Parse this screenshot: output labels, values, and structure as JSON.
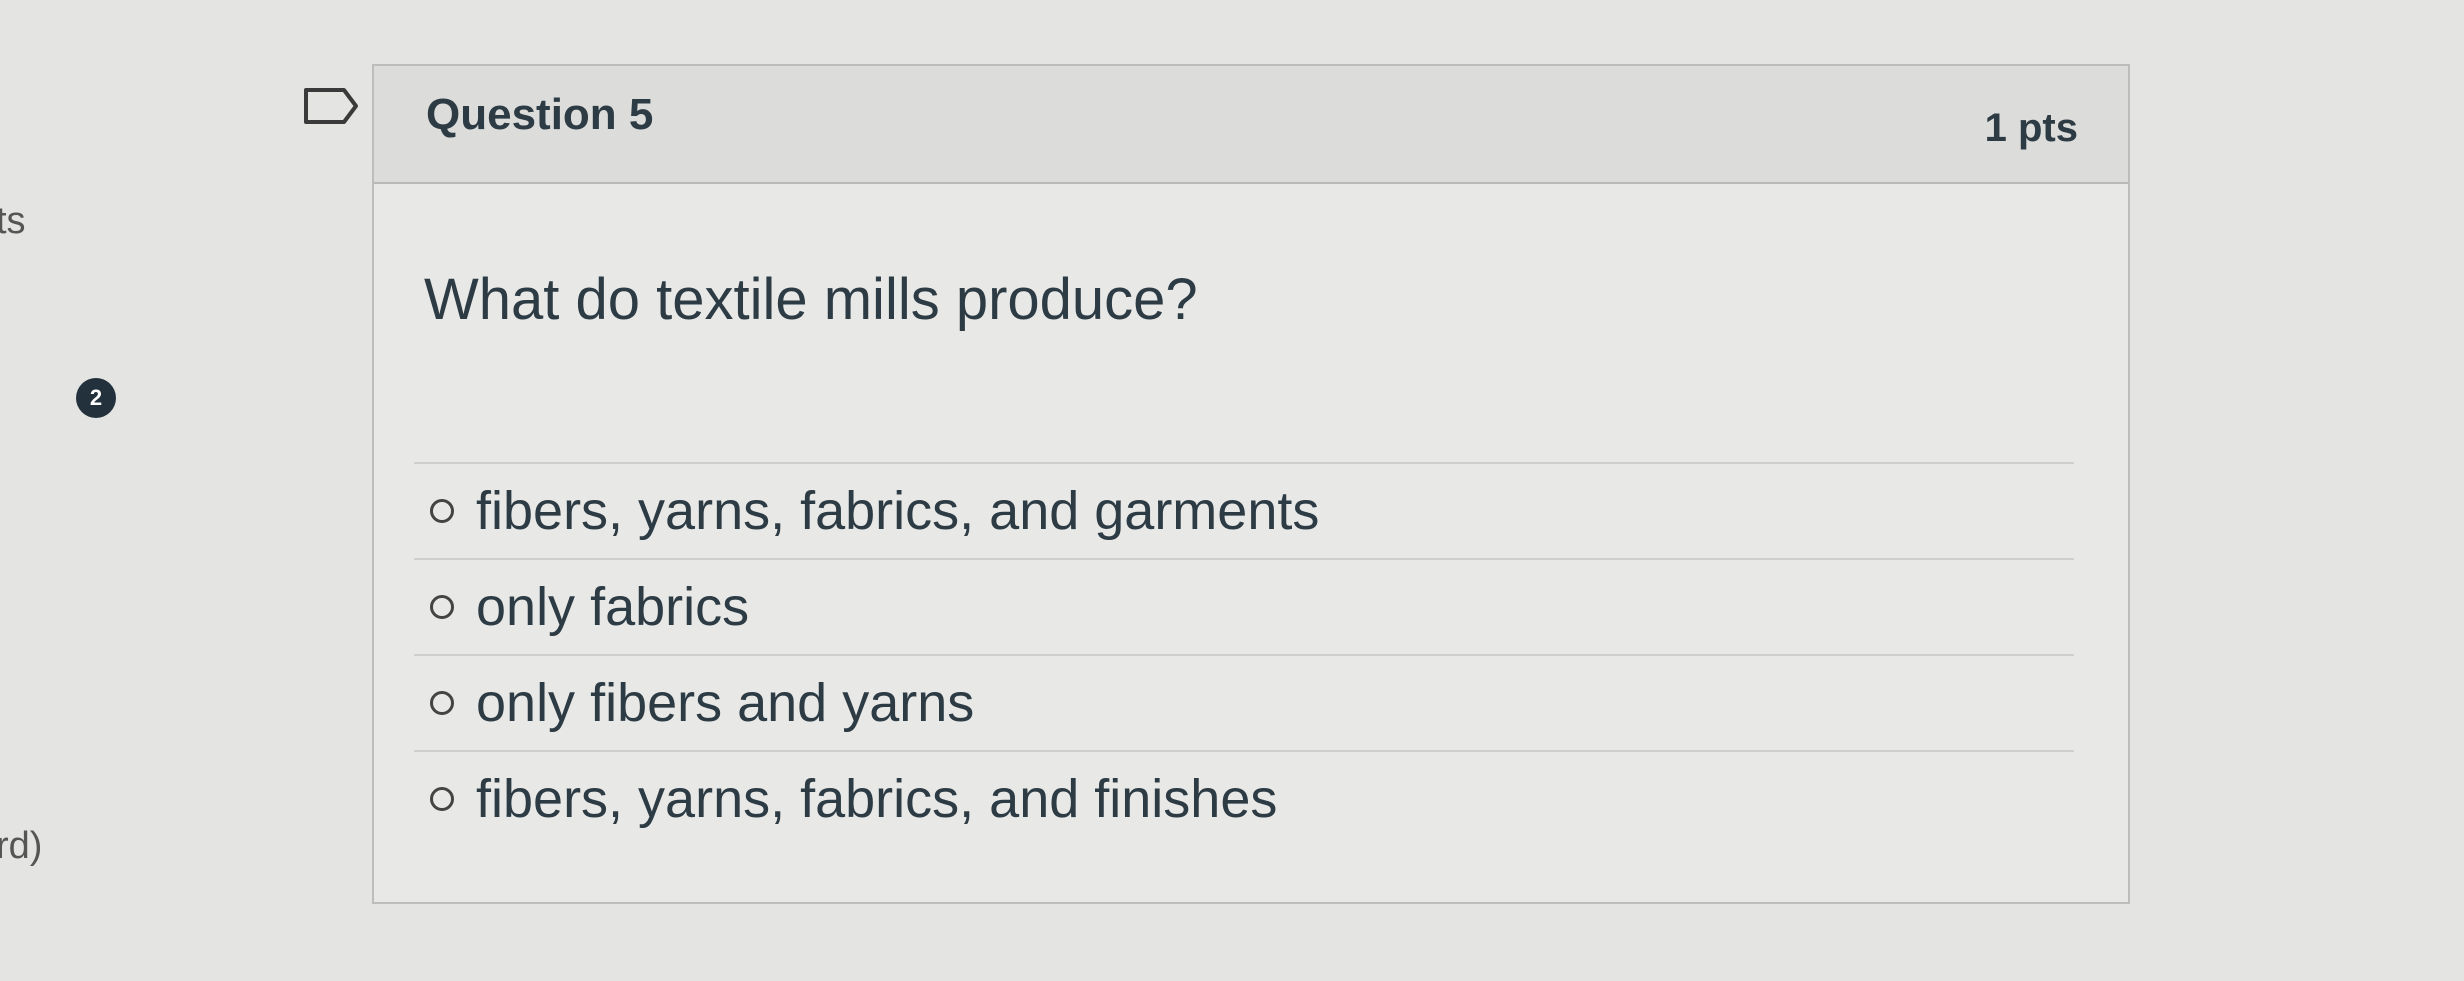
{
  "left_fragments": {
    "top": "ts",
    "bottom": "rd)"
  },
  "badge": {
    "count": "2"
  },
  "question": {
    "title": "Question 5",
    "points": "1 pts",
    "text": "What do textile mills produce?"
  },
  "answers": [
    {
      "label": "fibers, yarns, fabrics, and garments"
    },
    {
      "label": "only fabrics"
    },
    {
      "label": "only fibers and yarns"
    },
    {
      "label": "fibers, yarns, fabrics, and finishes"
    }
  ],
  "icons": {
    "flag": "flag-outline-icon",
    "radio": "radio-empty-icon"
  }
}
